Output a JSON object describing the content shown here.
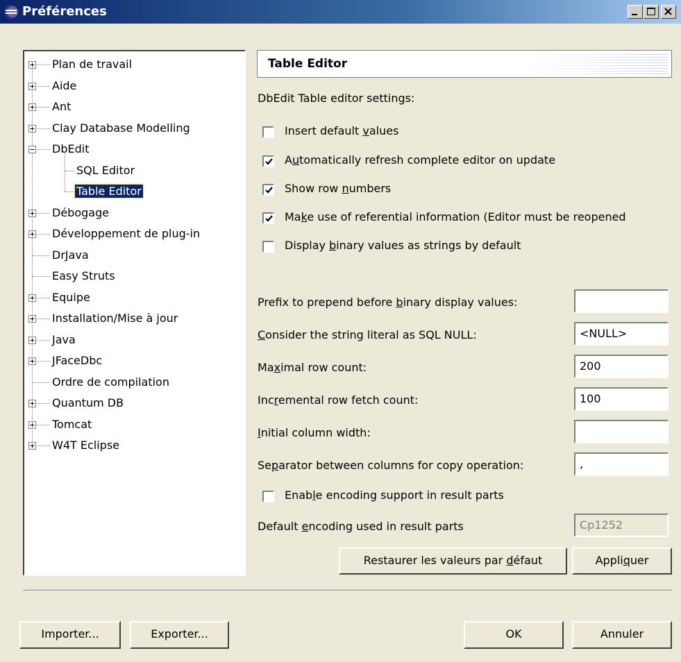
{
  "window": {
    "title": "Préférences",
    "controls": {
      "minimize": "_",
      "maximize": "□",
      "close": "×"
    }
  },
  "tree": {
    "items": [
      {
        "label": "Plan de travail",
        "expander": "+",
        "selected": false
      },
      {
        "label": "Aide",
        "expander": "+",
        "selected": false
      },
      {
        "label": "Ant",
        "expander": "+",
        "selected": false
      },
      {
        "label": "Clay Database Modelling",
        "expander": "+",
        "selected": false
      },
      {
        "label": "DbEdit",
        "expander": "-",
        "selected": false
      },
      {
        "label": "SQL Editor",
        "expander": "",
        "selected": false
      },
      {
        "label": "Table Editor",
        "expander": "",
        "selected": true
      },
      {
        "label": "Débogage",
        "expander": "+",
        "selected": false
      },
      {
        "label": "Développement de plug-in",
        "expander": "+",
        "selected": false
      },
      {
        "label": "DrJava",
        "expander": "",
        "selected": false
      },
      {
        "label": "Easy Struts",
        "expander": "",
        "selected": false
      },
      {
        "label": "Equipe",
        "expander": "+",
        "selected": false
      },
      {
        "label": "Installation/Mise à jour",
        "expander": "+",
        "selected": false
      },
      {
        "label": "Java",
        "expander": "+",
        "selected": false
      },
      {
        "label": "JFaceDbc",
        "expander": "+",
        "selected": false
      },
      {
        "label": "Ordre de compilation",
        "expander": "",
        "selected": false
      },
      {
        "label": "Quantum DB",
        "expander": "+",
        "selected": false
      },
      {
        "label": "Tomcat",
        "expander": "+",
        "selected": false
      },
      {
        "label": "W4T Eclipse",
        "expander": "+",
        "selected": false
      }
    ]
  },
  "page": {
    "title": "Table Editor",
    "description": "DbEdit Table editor settings:",
    "checkboxes": [
      {
        "label_pre": "Insert default ",
        "mnemonic": "v",
        "label_post": "alues",
        "checked": false
      },
      {
        "label_pre": "A",
        "mnemonic": "u",
        "label_post": "tomatically refresh complete editor on update",
        "checked": true
      },
      {
        "label_pre": "Show row ",
        "mnemonic": "n",
        "label_post": "umbers",
        "checked": true
      },
      {
        "label_pre": "Ma",
        "mnemonic": "k",
        "label_post": "e use of referential information (Editor must be reopened",
        "checked": true
      },
      {
        "label_pre": "Display ",
        "mnemonic": "b",
        "label_post": "inary values as strings by default",
        "checked": false
      }
    ],
    "fields": [
      {
        "label_pre": "Prefix to prepend before ",
        "mnemonic": "b",
        "label_post": "inary display values:",
        "value": "",
        "disabled": false
      },
      {
        "label_pre": "",
        "mnemonic": "C",
        "label_post": "onsider the string literal as SQL NULL:",
        "value": "<NULL>",
        "disabled": false
      },
      {
        "label_pre": "Ma",
        "mnemonic": "x",
        "label_post": "imal row count:",
        "value": "200",
        "disabled": false
      },
      {
        "label_pre": "Inc",
        "mnemonic": "r",
        "label_post": "emental row fetch count:",
        "value": "100",
        "disabled": false
      },
      {
        "label_pre": "",
        "mnemonic": "I",
        "label_post": "nitial column width:",
        "value": "",
        "disabled": false
      },
      {
        "label_pre": "Se",
        "mnemonic": "p",
        "label_post": "arator between columns for copy operation:",
        "value": ",",
        "disabled": false
      }
    ],
    "encoding_checkbox": {
      "label_pre": "Enab",
      "mnemonic": "l",
      "label_post": "e encoding support in result parts",
      "checked": false
    },
    "encoding_field": {
      "label_pre": "Default ",
      "mnemonic": "e",
      "label_post": "ncoding used in result parts",
      "value": "Cp1252",
      "disabled": true
    },
    "restore_button": {
      "label_pre": "Restaurer les valeurs par ",
      "mnemonic": "d",
      "label_post": "éfaut"
    },
    "apply_button": {
      "label_pre": "Appli",
      "mnemonic": "q",
      "label_post": "uer"
    }
  },
  "footer": {
    "import_label": "Importer...",
    "export_label": "Exporter...",
    "ok_label": "OK",
    "cancel_label": "Annuler"
  },
  "colors": {
    "title_bar": "#0a246a",
    "dialog_bg": "#ece9d8",
    "selection": "#0a246a"
  }
}
